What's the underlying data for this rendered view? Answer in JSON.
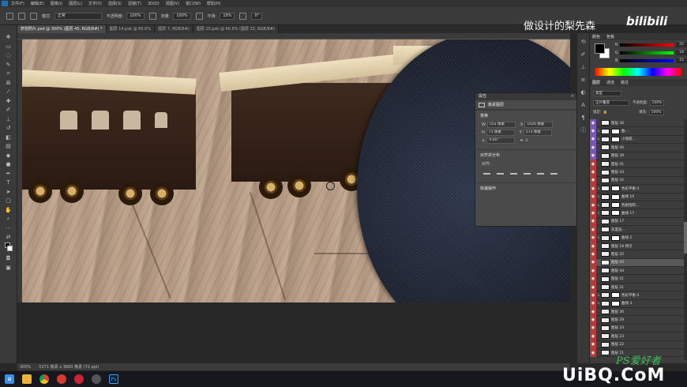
{
  "menu": {
    "items": [
      "文件(F)",
      "编辑(E)",
      "图像(I)",
      "图层(L)",
      "文字(Y)",
      "选择(S)",
      "滤镜(T)",
      "3D(D)",
      "视图(V)",
      "窗口(W)",
      "帮助(H)"
    ]
  },
  "options": {
    "mode_label": "模式:",
    "mode_value": "正常",
    "opacity_label": "不透明度:",
    "opacity_value": "100%",
    "flow_label": "流量:",
    "flow_value": "100%",
    "smooth_label": "平滑:",
    "smooth_value": "10%",
    "angle_value": "0°"
  },
  "tabs": [
    {
      "label": "梦想照片.psd @ 300% (图层 45, RGB/8#) *",
      "active": true
    },
    {
      "label": "图层 14.psb @ 66.6%",
      "active": false
    },
    {
      "label": "图层 7, RGB/8#)",
      "active": false
    },
    {
      "label": "图层 15.psb @ 66.6% (图层 15, RGB/8#)",
      "active": false
    }
  ],
  "watermarks": {
    "channel_name": "做设计的梨先森",
    "bilibili": "bilibili",
    "site": "UiBQ.CoM",
    "ps_brand": "PS爱好者"
  },
  "properties_panel": {
    "title": "属性",
    "layer_type": "像素图层",
    "section_transform": "变换",
    "w_label": "W",
    "w_value": "553 像素",
    "x_label": "X",
    "x_value": "1026 像素",
    "h_label": "H",
    "h_value": "71 像素",
    "y_label": "Y",
    "y_value": "573 像素",
    "angle_value": "0.00°",
    "section_align": "对齐并分布",
    "align_label": "对齐:",
    "section_quick": "快速操作"
  },
  "color_panel": {
    "tab_color": "颜色",
    "tab_swatches": "色板",
    "r_value": "25",
    "g_value": "18",
    "b_value": "15",
    "fg_color": "#000000",
    "bg_color": "#ffffff"
  },
  "layers_panel": {
    "tab_layers": "图层",
    "tab_channels": "通道",
    "tab_paths": "路径",
    "filter_label": "类型",
    "blend_mode": "正片叠底",
    "opacity_label": "不透明度:",
    "opacity_value": "100%",
    "lock_label": "锁定:",
    "fill_label": "填充:",
    "fill_value": "100%",
    "layers": [
      {
        "name": "图层 36",
        "color": "purple",
        "mask": false,
        "selected": false
      },
      {
        "name": "曲...",
        "color": "purple",
        "mask": true,
        "selected": false
      },
      {
        "name": "小瑕疵...",
        "color": "purple",
        "mask": true,
        "selected": false
      },
      {
        "name": "图层 40",
        "color": "purple",
        "mask": false,
        "selected": false
      },
      {
        "name": "图层 39",
        "color": "purple",
        "mask": false,
        "selected": false
      },
      {
        "name": "图层 41",
        "color": "red",
        "mask": false,
        "selected": false
      },
      {
        "name": "图层 43",
        "color": "red",
        "mask": false,
        "selected": false
      },
      {
        "name": "图层 42",
        "color": "red",
        "mask": false,
        "selected": false
      },
      {
        "name": "色彩平衡 4",
        "color": "red",
        "mask": true,
        "selected": false
      },
      {
        "name": "曲线 10",
        "color": "red",
        "mask": true,
        "selected": false
      },
      {
        "name": "色相饱和...",
        "color": "red",
        "mask": true,
        "selected": false
      },
      {
        "name": "曲线 17",
        "color": "red",
        "mask": true,
        "selected": false
      },
      {
        "name": "图层 17",
        "color": "red",
        "mask": false,
        "selected": false
      },
      {
        "name": "灰度层...",
        "color": "red",
        "mask": false,
        "selected": false
      },
      {
        "name": "曲线 2",
        "color": "red",
        "mask": true,
        "selected": false
      },
      {
        "name": "图层 18 拷贝",
        "color": "red",
        "mask": false,
        "selected": false
      },
      {
        "name": "图层 35",
        "color": "red",
        "mask": false,
        "selected": false
      },
      {
        "name": "图层 45",
        "color": "red",
        "mask": false,
        "selected": true
      },
      {
        "name": "图层 44",
        "color": "red",
        "mask": false,
        "selected": false
      },
      {
        "name": "图层 41",
        "color": "red",
        "mask": false,
        "selected": false
      },
      {
        "name": "图层 31",
        "color": "red",
        "mask": false,
        "selected": false
      },
      {
        "name": "色彩平衡 4",
        "color": "red",
        "mask": true,
        "selected": false
      },
      {
        "name": "曲线 3",
        "color": "red",
        "mask": true,
        "selected": false
      },
      {
        "name": "图层 30",
        "color": "red",
        "mask": false,
        "selected": false
      },
      {
        "name": "图层 29",
        "color": "red",
        "mask": false,
        "selected": false
      },
      {
        "name": "图层 24",
        "color": "red",
        "mask": false,
        "selected": false
      },
      {
        "name": "图层 23",
        "color": "red",
        "mask": false,
        "selected": false
      },
      {
        "name": "图层 22",
        "color": "red",
        "mask": false,
        "selected": false
      },
      {
        "name": "图层 21",
        "color": "red",
        "mask": false,
        "selected": false
      }
    ]
  },
  "status": {
    "zoom": "300%",
    "doc_info": "5271 像素 x 3660 像素 (72 ppi)"
  }
}
